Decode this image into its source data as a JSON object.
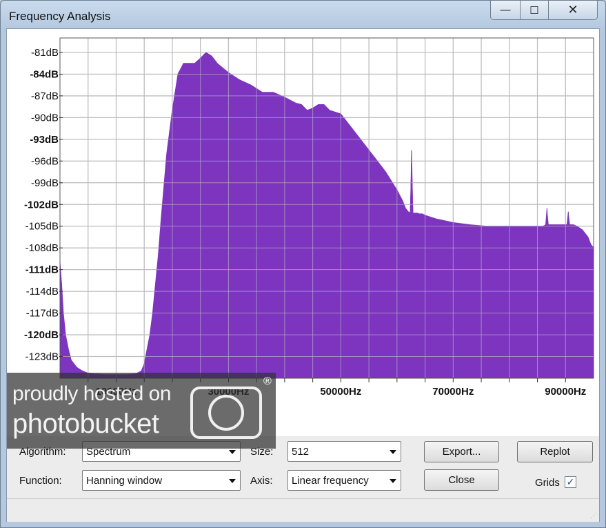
{
  "window": {
    "title": "Frequency Analysis",
    "minimize_glyph": "—",
    "maximize_glyph": "☐",
    "close_glyph": "✕"
  },
  "chart_data": {
    "type": "area",
    "title": "",
    "xlabel": "",
    "ylabel": "",
    "x_unit": "Hz",
    "y_unit": "dB",
    "xlim": [
      0,
      95000
    ],
    "ylim": [
      -126,
      -79
    ],
    "grid": true,
    "fill_color": "#7d35c0",
    "x_tick_labels": [
      "10000Hz",
      "30000Hz",
      "50000Hz",
      "70000Hz",
      "90000Hz"
    ],
    "y_tick_labels": [
      "-81dB",
      "-84dB",
      "-87dB",
      "-90dB",
      "-93dB",
      "-96dB",
      "-99dB",
      "-102dB",
      "-105dB",
      "-108dB",
      "-111dB",
      "-114dB",
      "-117dB",
      "-120dB",
      "-123dB"
    ],
    "series": [
      {
        "x": [
          0,
          300,
          600,
          1000,
          1500,
          2000,
          3000,
          4000,
          5000,
          6000,
          8000,
          10000,
          12000,
          13500,
          14500,
          15000,
          15500,
          16000,
          16500,
          17000,
          17500,
          18000,
          19000,
          20000,
          21000,
          22000,
          23000,
          24000,
          25000,
          26000,
          27000,
          28000,
          30000,
          32000,
          34000,
          36000,
          38000,
          40000,
          42000,
          43000,
          44000,
          45000,
          46000,
          47000,
          48000,
          50000,
          52000,
          54000,
          56000,
          58000,
          60000,
          61000,
          61500,
          62000,
          62400,
          62800,
          63200,
          63600,
          64000,
          64500,
          65000,
          67000,
          70000,
          73000,
          76000,
          80000,
          84000,
          86000,
          86500,
          86800,
          87200,
          87600,
          88000,
          89000,
          90000,
          90300,
          90600,
          91000,
          91400,
          92000,
          93000,
          94000,
          94500,
          95000
        ],
        "values": [
          -110,
          -113,
          -117,
          -120,
          -122,
          -123.5,
          -124.5,
          -125,
          -125.3,
          -125.4,
          -125.5,
          -125.5,
          -125.5,
          -125.4,
          -125,
          -124,
          -122,
          -120,
          -117,
          -113,
          -109,
          -104,
          -95,
          -89,
          -84,
          -82.5,
          -82.5,
          -82.5,
          -81.8,
          -81,
          -81.5,
          -82.5,
          -83.8,
          -84.8,
          -85.5,
          -86.5,
          -86.5,
          -87.2,
          -88,
          -88.2,
          -89,
          -88.7,
          -88.2,
          -88.2,
          -89,
          -89.5,
          -91.5,
          -93.5,
          -95.5,
          -97.5,
          -100,
          -101.5,
          -102.5,
          -103,
          -103.2,
          -103.2,
          -103.2,
          -103.2,
          -103.3,
          -103.3,
          -103.5,
          -104,
          -104.5,
          -104.8,
          -105,
          -105,
          -105,
          -105,
          -104.8,
          -104.8,
          -104.8,
          -104.8,
          -104.8,
          -104.8,
          -104.8,
          -104.8,
          -104.8,
          -104.8,
          -104.8,
          -105,
          -105.5,
          -106.5,
          -107.5,
          -108
        ]
      }
    ],
    "spikes": [
      {
        "x": 62600,
        "value": -94.5
      },
      {
        "x": 86700,
        "value": -102.5
      },
      {
        "x": 90500,
        "value": -103
      }
    ]
  },
  "controls": {
    "algorithm_label": "Algorithm:",
    "algorithm_value": "Spectrum",
    "function_label": "Function:",
    "function_value": "Hanning window",
    "size_label": "Size:",
    "size_value": "512",
    "axis_label": "Axis:",
    "axis_value": "Linear frequency",
    "export_label": "Export...",
    "replot_label": "Replot",
    "close_label": "Close",
    "grids_label": "Grids",
    "grids_checked": true,
    "check_glyph": "✓"
  },
  "watermark": {
    "line1": "proudly hosted on",
    "line2": "photobucket",
    "registered": "®"
  }
}
